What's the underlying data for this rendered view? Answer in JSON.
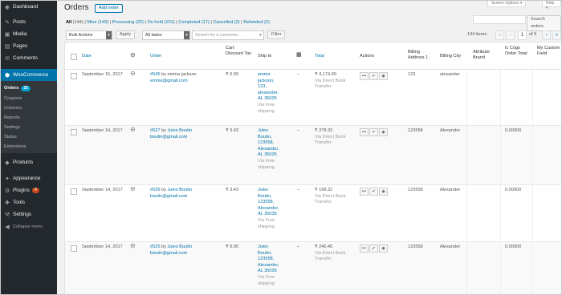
{
  "sidebar": {
    "items": [
      {
        "label": "Dashboard",
        "icon": "dashboard-icon",
        "glyph": "◉"
      },
      {
        "label": "Posts",
        "icon": "pin-icon",
        "glyph": "✎"
      },
      {
        "label": "Media",
        "icon": "media-icon",
        "glyph": "▣"
      },
      {
        "label": "Pages",
        "icon": "pages-icon",
        "glyph": "▤"
      },
      {
        "label": "Comments",
        "icon": "comment-icon",
        "glyph": "✉"
      }
    ],
    "woocommerce": "WooCommerce",
    "submenu": [
      {
        "label": "Orders",
        "badge": "25"
      },
      {
        "label": "Coupons"
      },
      {
        "label": "Columns"
      },
      {
        "label": "Reports"
      },
      {
        "label": "Settings"
      },
      {
        "label": "Status"
      },
      {
        "label": "Extensions"
      }
    ],
    "lower": [
      {
        "label": "Products",
        "glyph": "◆"
      },
      {
        "label": "Appearance",
        "glyph": "✦"
      },
      {
        "label": "Plugins",
        "glyph": "⚙",
        "badge": "4"
      },
      {
        "label": "Tools",
        "glyph": "✚"
      },
      {
        "label": "Settings",
        "glyph": "⚒"
      },
      {
        "label": "Collapse menu",
        "glyph": "◀"
      }
    ]
  },
  "header": {
    "title": "Orders",
    "add_order": "Add order",
    "screen_options": "Screen Options ▾",
    "help": "Help ▾",
    "search_button": "Search orders"
  },
  "status_links": [
    {
      "label": "All",
      "count": "(144)",
      "current": true
    },
    {
      "label": "Mine",
      "count": "(143)"
    },
    {
      "label": "Processing",
      "count": "(22)"
    },
    {
      "label": "On hold",
      "count": "(101)"
    },
    {
      "label": "Completed",
      "count": "(17)"
    },
    {
      "label": "Cancelled",
      "count": "(2)"
    },
    {
      "label": "Refunded",
      "count": "(2)"
    }
  ],
  "filters": {
    "bulk_actions": "Bulk Actions",
    "apply": "Apply",
    "all_dates": "All dates",
    "customer_placeholder": "Search for a customer...",
    "filter": "Filter"
  },
  "pagination": {
    "count": "144 items",
    "first": "«",
    "prev": "‹",
    "page": "1",
    "of": "of 6",
    "next": "›",
    "last": "»"
  },
  "columns": {
    "date": "Date",
    "order": "Order",
    "cart_discount_tax": "Cart Discount Tax",
    "ship_to": "Ship to",
    "total": "Total",
    "actions": "Actions",
    "billing_address_1": "Billing Address 1",
    "billing_city": "Billing City",
    "attribute_brand": "Attribute Brand",
    "cogs": "Ic Cogs Order Total",
    "custom_field": "My Custom Field"
  },
  "orders": [
    {
      "date": "September 15, 2017",
      "order_num": "#545",
      "by": "by emma jackson",
      "email": "emma@gmail.com",
      "tax": "₹ 0.00",
      "ship_to": [
        "emma",
        "jackson,",
        "123,",
        "alexander,",
        "AL 35035"
      ],
      "via_ship": "Via Free shipping",
      "dash": "–",
      "total": "₹ 4,174.00",
      "via_pay": "Via Direct Bank Transfer",
      "billing_address": "123",
      "billing_city": "alexander",
      "cogs": ""
    },
    {
      "date": "September 14, 2017",
      "order_num": "#527",
      "by": "by",
      "name": "Jules Boutin",
      "email": "boutin@gmail.com",
      "tax": "₹ 3.43",
      "ship_to": [
        "Jules",
        "Boutin,",
        "123558,",
        "Alexander,",
        "AL 35035"
      ],
      "via_ship": "Via Free shipping",
      "dash": "–",
      "total": "₹ 378.32",
      "via_pay": "Via Direct Bank Transfer",
      "billing_address": "123558",
      "billing_city": "Alexander",
      "cogs": "0.00000"
    },
    {
      "date": "September 14, 2017",
      "order_num": "#526",
      "by": "by",
      "name": "Jules Boutin",
      "email": "boutin@gmail.com",
      "tax": "₹ 3.43",
      "ship_to": [
        "Jules",
        "Boutin,",
        "123558,",
        "Alexander,",
        "AL 35035"
      ],
      "via_ship": "Via Free shipping",
      "dash": "–",
      "total": "₹ 168.32",
      "via_pay": "Via Direct Bank Transfer",
      "billing_address": "123558",
      "billing_city": "Alexander",
      "cogs": "0.00000"
    },
    {
      "date": "September 14, 2017",
      "order_num": "#525",
      "by": "by",
      "name": "Jules Boutin",
      "email": "boutin@gmail.com",
      "tax": "₹ 0.00",
      "ship_to": [
        "Jules",
        "Boutin,",
        "123558,",
        "Alexander,",
        "AL 35035"
      ],
      "via_ship": "Via Free shipping",
      "dash": "–",
      "total": "₹ 240.45",
      "via_pay": "Via Direct Bank Transfer",
      "billing_address": "123558",
      "billing_city": "Alexander",
      "cogs": "0.00000"
    }
  ],
  "colors": {
    "sidebar": "#23282d",
    "active": "#0073aa",
    "link": "#0073aa",
    "badge": "#ca4a1f"
  }
}
